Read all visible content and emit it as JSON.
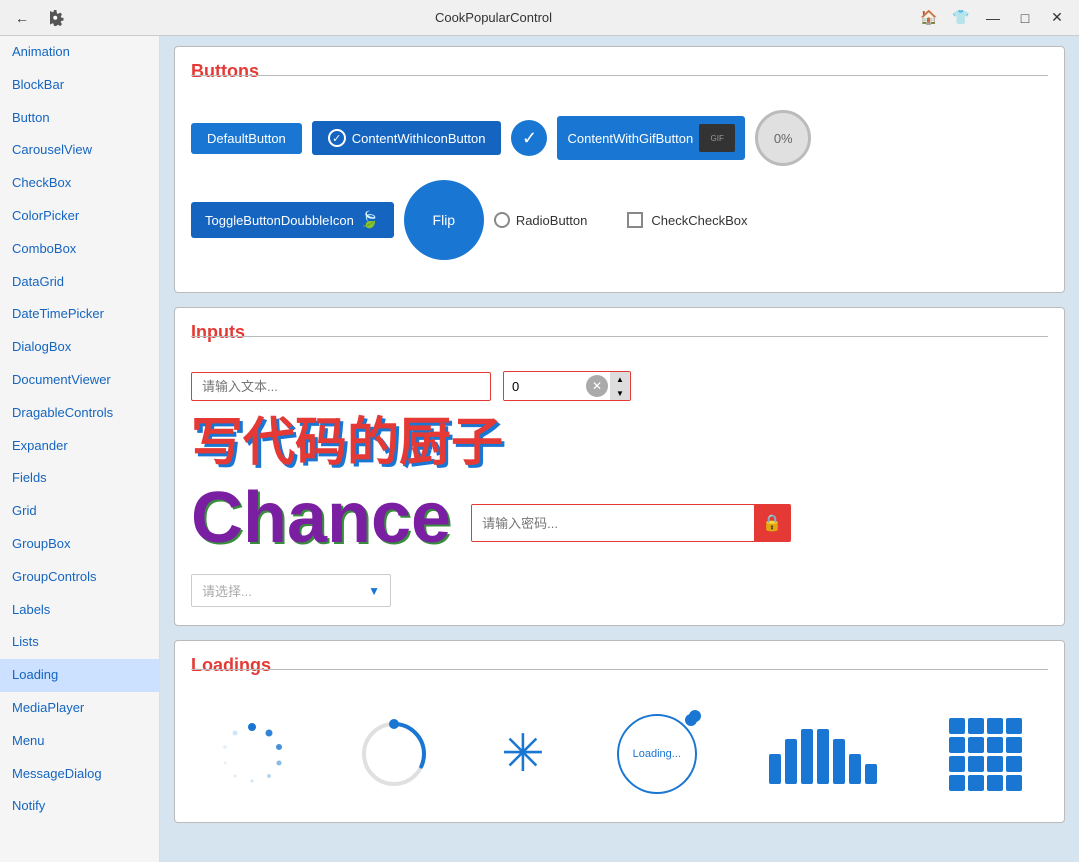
{
  "titlebar": {
    "title": "CookPopularControl",
    "back_icon": "←",
    "settings_icon": "⚙",
    "home_icon": "🏠",
    "shirt_icon": "👕",
    "min_icon": "—",
    "max_icon": "□",
    "close_icon": "✕"
  },
  "sidebar": {
    "items": [
      {
        "label": "Animation",
        "active": false
      },
      {
        "label": "BlockBar",
        "active": false
      },
      {
        "label": "Button",
        "active": false
      },
      {
        "label": "CarouselView",
        "active": false
      },
      {
        "label": "CheckBox",
        "active": false
      },
      {
        "label": "ColorPicker",
        "active": false
      },
      {
        "label": "ComboBox",
        "active": false
      },
      {
        "label": "DataGrid",
        "active": false
      },
      {
        "label": "DateTimePicker",
        "active": false
      },
      {
        "label": "DialogBox",
        "active": false
      },
      {
        "label": "DocumentViewer",
        "active": false
      },
      {
        "label": "DragableControls",
        "active": false
      },
      {
        "label": "Expander",
        "active": false
      },
      {
        "label": "Fields",
        "active": false
      },
      {
        "label": "Grid",
        "active": false
      },
      {
        "label": "GroupBox",
        "active": false
      },
      {
        "label": "GroupControls",
        "active": false
      },
      {
        "label": "Labels",
        "active": false
      },
      {
        "label": "Lists",
        "active": false
      },
      {
        "label": "Loading",
        "active": true
      },
      {
        "label": "MediaPlayer",
        "active": false
      },
      {
        "label": "Menu",
        "active": false
      },
      {
        "label": "MessageDialog",
        "active": false
      },
      {
        "label": "Notify",
        "active": false
      }
    ]
  },
  "buttons_section": {
    "title": "Buttons",
    "default_btn": "DefaultButton",
    "icon_btn": "ContentWithIconButton",
    "gif_btn": "ContentWithGifButton",
    "percent_btn": "0%",
    "toggle_btn": "ToggleButtonDoubbleIcon",
    "flip_btn": "Flip",
    "radio_btn": "RadioButton",
    "check_btn": "CheckCheckBox"
  },
  "inputs_section": {
    "title": "Inputs",
    "text_placeholder": "请输入文本...",
    "number_value": "0",
    "big_chinese": "写代码的厨子",
    "big_chance": "Chance",
    "password_placeholder": "请输入密码...",
    "select_placeholder": "请选择..."
  },
  "loadings_section": {
    "title": "Loadings",
    "circle_text": "Loading..."
  }
}
